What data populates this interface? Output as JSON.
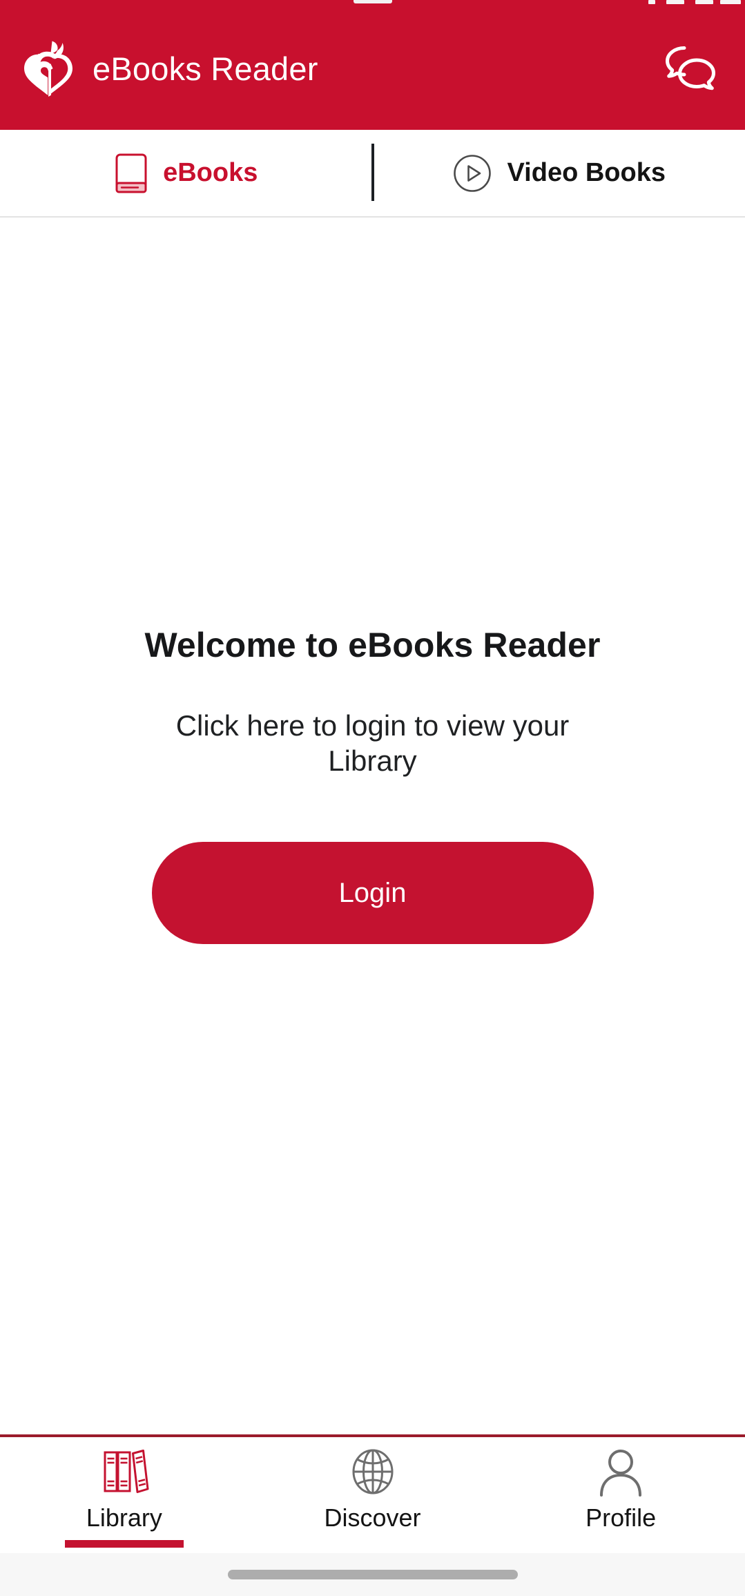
{
  "statusbar": {
    "present": true
  },
  "header": {
    "logo_name": "aha-heart-torch-logo",
    "title": "eBooks Reader",
    "chat_icon": "chat-bubbles-icon",
    "background_color": "#C8102E",
    "text_color": "#FFFFFF"
  },
  "tabs": {
    "items": [
      {
        "id": "ebooks",
        "label": "eBooks",
        "icon": "book-icon",
        "active": true,
        "color": "#C8102E"
      },
      {
        "id": "video-books",
        "label": "Video Books",
        "icon": "play-circle-icon",
        "active": false,
        "color": "#141414"
      }
    ]
  },
  "main": {
    "title": "Welcome to eBooks Reader",
    "subtitle": "Click here to login to view your Library",
    "login_label": "Login",
    "login_color": "#C41230"
  },
  "bottomnav": {
    "items": [
      {
        "id": "library",
        "label": "Library",
        "icon": "books-icon",
        "active": true,
        "color": "#C41230"
      },
      {
        "id": "discover",
        "label": "Discover",
        "icon": "globe-icon",
        "active": false,
        "color": "#6E6E6E"
      },
      {
        "id": "profile",
        "label": "Profile",
        "icon": "person-icon",
        "active": false,
        "color": "#6E6E6E"
      }
    ],
    "accent_color": "#C41230"
  }
}
